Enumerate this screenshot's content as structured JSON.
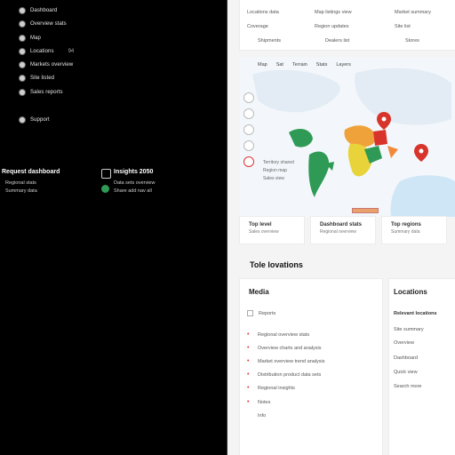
{
  "sidebar": {
    "items": [
      {
        "label": "Dashboard",
        "icon": "dot-icon"
      },
      {
        "label": "Overview stats",
        "icon": "dot-icon"
      },
      {
        "label": "Map",
        "icon": "dot-icon"
      },
      {
        "label": "Locations",
        "extra": "94",
        "icon": "dot-icon"
      },
      {
        "label": "Markets overview",
        "icon": "dot-icon"
      },
      {
        "label": "Site listed",
        "icon": "dot-icon"
      },
      {
        "label": "Sales reports",
        "icon": "dot-icon"
      },
      {
        "label": "Support",
        "icon": "dot-icon"
      }
    ],
    "panel_left": {
      "title": "Request dashboard",
      "lines": [
        "Regional stats",
        "Summary data"
      ]
    },
    "panel_right": {
      "title": "Insights 2050",
      "lines": [
        "Data sets overview",
        "Share add  nav  all"
      ]
    }
  },
  "top_table": {
    "rows": [
      [
        "Locations data",
        "Map listings view",
        "Market summary"
      ],
      [
        "Coverage",
        "Region updates",
        "Site list"
      ],
      [
        "Shipments",
        "Dealers list",
        "Stores"
      ]
    ]
  },
  "map": {
    "tabs": [
      "Map",
      "Sat",
      "Terrain",
      "Stats",
      "Layers"
    ],
    "legend": [
      "Territory shared",
      "Region map",
      "Sales view"
    ],
    "colors": {
      "green": "#2e9a55",
      "orange": "#f0a23a",
      "red": "#d8342c",
      "yellow": "#e8d43a",
      "water": "#cfe6f6",
      "land": "#e6eef5"
    }
  },
  "stats": [
    {
      "title": "Top level",
      "sub": "Sales overview"
    },
    {
      "title": "Dashboard stats",
      "sub": "Regional overview"
    },
    {
      "title": "Top regions",
      "sub": "Summary data"
    }
  ],
  "section_title": "Tole lovations",
  "media": {
    "title": "Media",
    "rows": [
      "Reports",
      "Regional overview stats",
      "Overview charts and analysis",
      "Market overview trend analysis",
      "Distribution product data sets",
      "Regional insights",
      "Notes",
      "Info"
    ]
  },
  "locations": {
    "title": "Locations",
    "subtitle": "Relevant locations",
    "rows": [
      "Site summary",
      "Overview",
      "Dashboard",
      "Quick view",
      "Search more"
    ]
  }
}
